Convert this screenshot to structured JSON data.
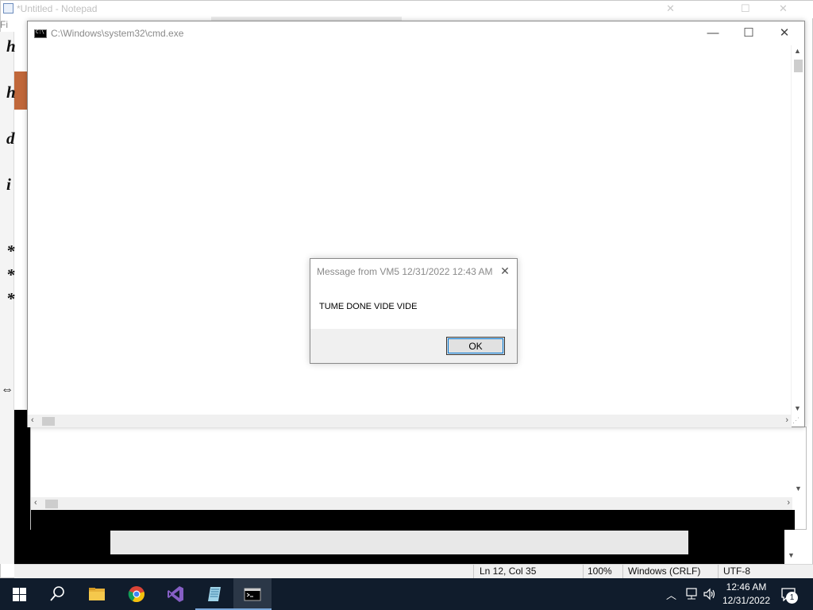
{
  "notepad": {
    "title": "*Untitled - Notepad",
    "menu_first": "Fi",
    "text_lines": [
      "h",
      "h",
      "d",
      "i",
      "*",
      "*",
      "*"
    ],
    "status": {
      "position": "Ln 12, Col 35",
      "zoom": "100%",
      "line_ending": "Windows (CRLF)",
      "encoding": "UTF-8"
    }
  },
  "cmd": {
    "title": "C:\\Windows\\system32\\cmd.exe",
    "minimize": "—",
    "maximize": "☐",
    "close": "✕"
  },
  "message": {
    "title": "Message from VM5 12/31/2022 12:43 AM",
    "body": "TUME DONE VIDE VIDE",
    "ok": "OK",
    "close": "✕"
  },
  "taskbar": {
    "apps": [
      "start",
      "search",
      "file-explorer",
      "chrome",
      "visual-studio",
      "notepad",
      "cmd"
    ],
    "clock_time": "12:46 AM",
    "clock_date": "12/31/2022",
    "notification_count": "1"
  },
  "colors": {
    "taskbar": "#101c2c",
    "accent": "#0078d7"
  }
}
